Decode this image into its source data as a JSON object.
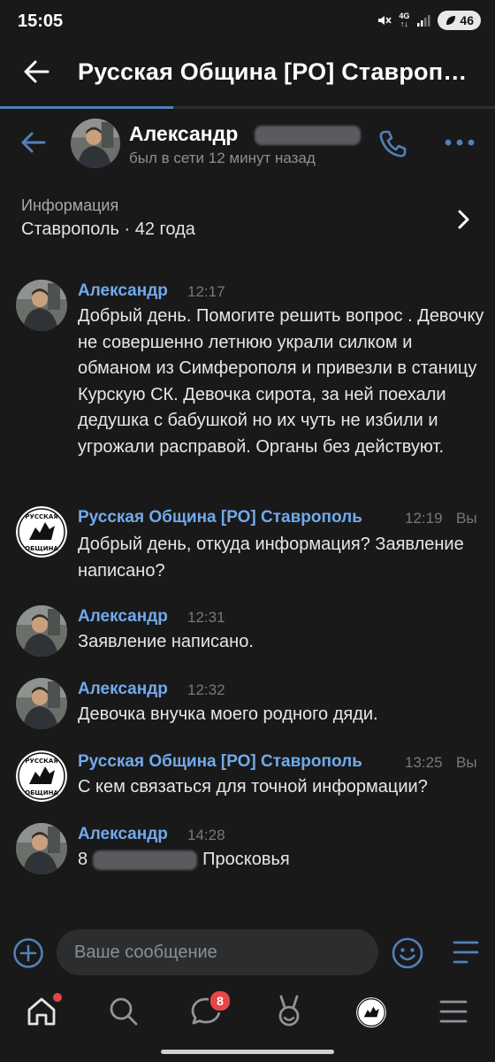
{
  "status_bar": {
    "time": "15:05",
    "network_top": "4G",
    "network_bottom": "↑↓",
    "battery": "46",
    "icons": [
      "mute-icon",
      "signal-icon",
      "battery-icon"
    ]
  },
  "header": {
    "title": "Русская Община [РО] Ставрополь",
    "loading_progress": 0.35
  },
  "chat_header": {
    "name": "Александр",
    "status": "был в сети 12 минут назад"
  },
  "info": {
    "label": "Информация",
    "value": "Ставрополь · 42 года"
  },
  "messages": [
    {
      "author": "Александр",
      "time": "12:17",
      "text": "Добрый день. Помогите решить вопрос . Девочку не совершенно летнюю украли силком и обманом из Симферополя и привезли в станицу Курскую СК. Девочка сирота, за ней поехали дедушка с бабушкой но их чуть не избили и угрожали расправой. Органы без действуют."
    },
    {
      "author": "Русская Община [РО] Ставрополь",
      "time": "12:19",
      "you": "Вы",
      "text": "Добрый день, откуда информация? Заявление написано?"
    },
    {
      "author": "Александр",
      "time": "12:31",
      "text": "Заявление написано."
    },
    {
      "author": "Александр",
      "time": "12:32",
      "text": "Девочка внучка моего родного дяди."
    },
    {
      "author": "Русская Община [РО] Ставрополь",
      "time": "13:25",
      "you": "Вы",
      "text": "С кем связаться для точной информации?"
    },
    {
      "author": "Александр",
      "time": "14:28",
      "text_prefix": "8",
      "text_suffix": "Просковья"
    }
  ],
  "logo_text": {
    "top": "РУССКАЯ",
    "bottom": "ОБЩИНА"
  },
  "composer": {
    "placeholder": "Ваше сообщение"
  },
  "bottom_nav": {
    "items": [
      "home-icon",
      "search-icon",
      "messages-icon",
      "clips-icon",
      "community-avatar",
      "menu-icon"
    ],
    "messages_badge": "8"
  },
  "colors": {
    "background": "#19191a",
    "accent": "#71aaeb",
    "icon_blue": "#5181b8",
    "badge": "#e64646"
  }
}
